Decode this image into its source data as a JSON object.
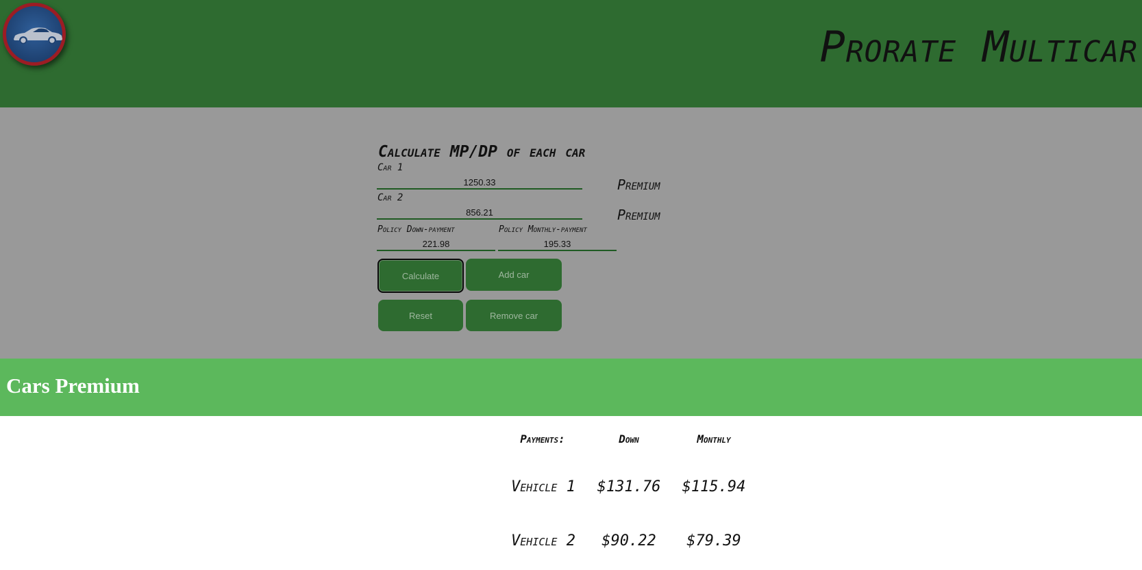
{
  "header": {
    "title": "Prorate Multicar",
    "logo_icon": "car-icon"
  },
  "form": {
    "title": "Calculate MP/DP of each car",
    "car1": {
      "label": "Car 1",
      "value": "1250.33",
      "premium_label": "Premium"
    },
    "car2": {
      "label": "Car 2",
      "value": "856.21",
      "premium_label": "Premium"
    },
    "down_payment": {
      "label": "Policy Down-payment",
      "value": "221.98"
    },
    "monthly_payment": {
      "label": "Policy Monthly-payment",
      "value": "195.33"
    },
    "buttons": {
      "calculate": "Calculate",
      "add_car": "Add car",
      "reset": "Reset",
      "remove_car": "Remove car"
    }
  },
  "banner": {
    "title": "Cars Premium"
  },
  "results": {
    "headers": {
      "payments": "Payments:",
      "down": "Down",
      "monthly": "Monthly"
    },
    "rows": [
      {
        "vehicle": "Vehicle 1",
        "down": "$131.76",
        "monthly": "$115.94"
      },
      {
        "vehicle": "Vehicle 2",
        "down": "$90.22",
        "monthly": "$79.39"
      }
    ]
  },
  "colors": {
    "header_bg": "#2e6b30",
    "form_bg": "#999999",
    "banner_bg": "#5cb85c",
    "button_bg": "#2e6b30",
    "logo_ring": "#9c1c24",
    "logo_fill": "#1d3f6e"
  }
}
